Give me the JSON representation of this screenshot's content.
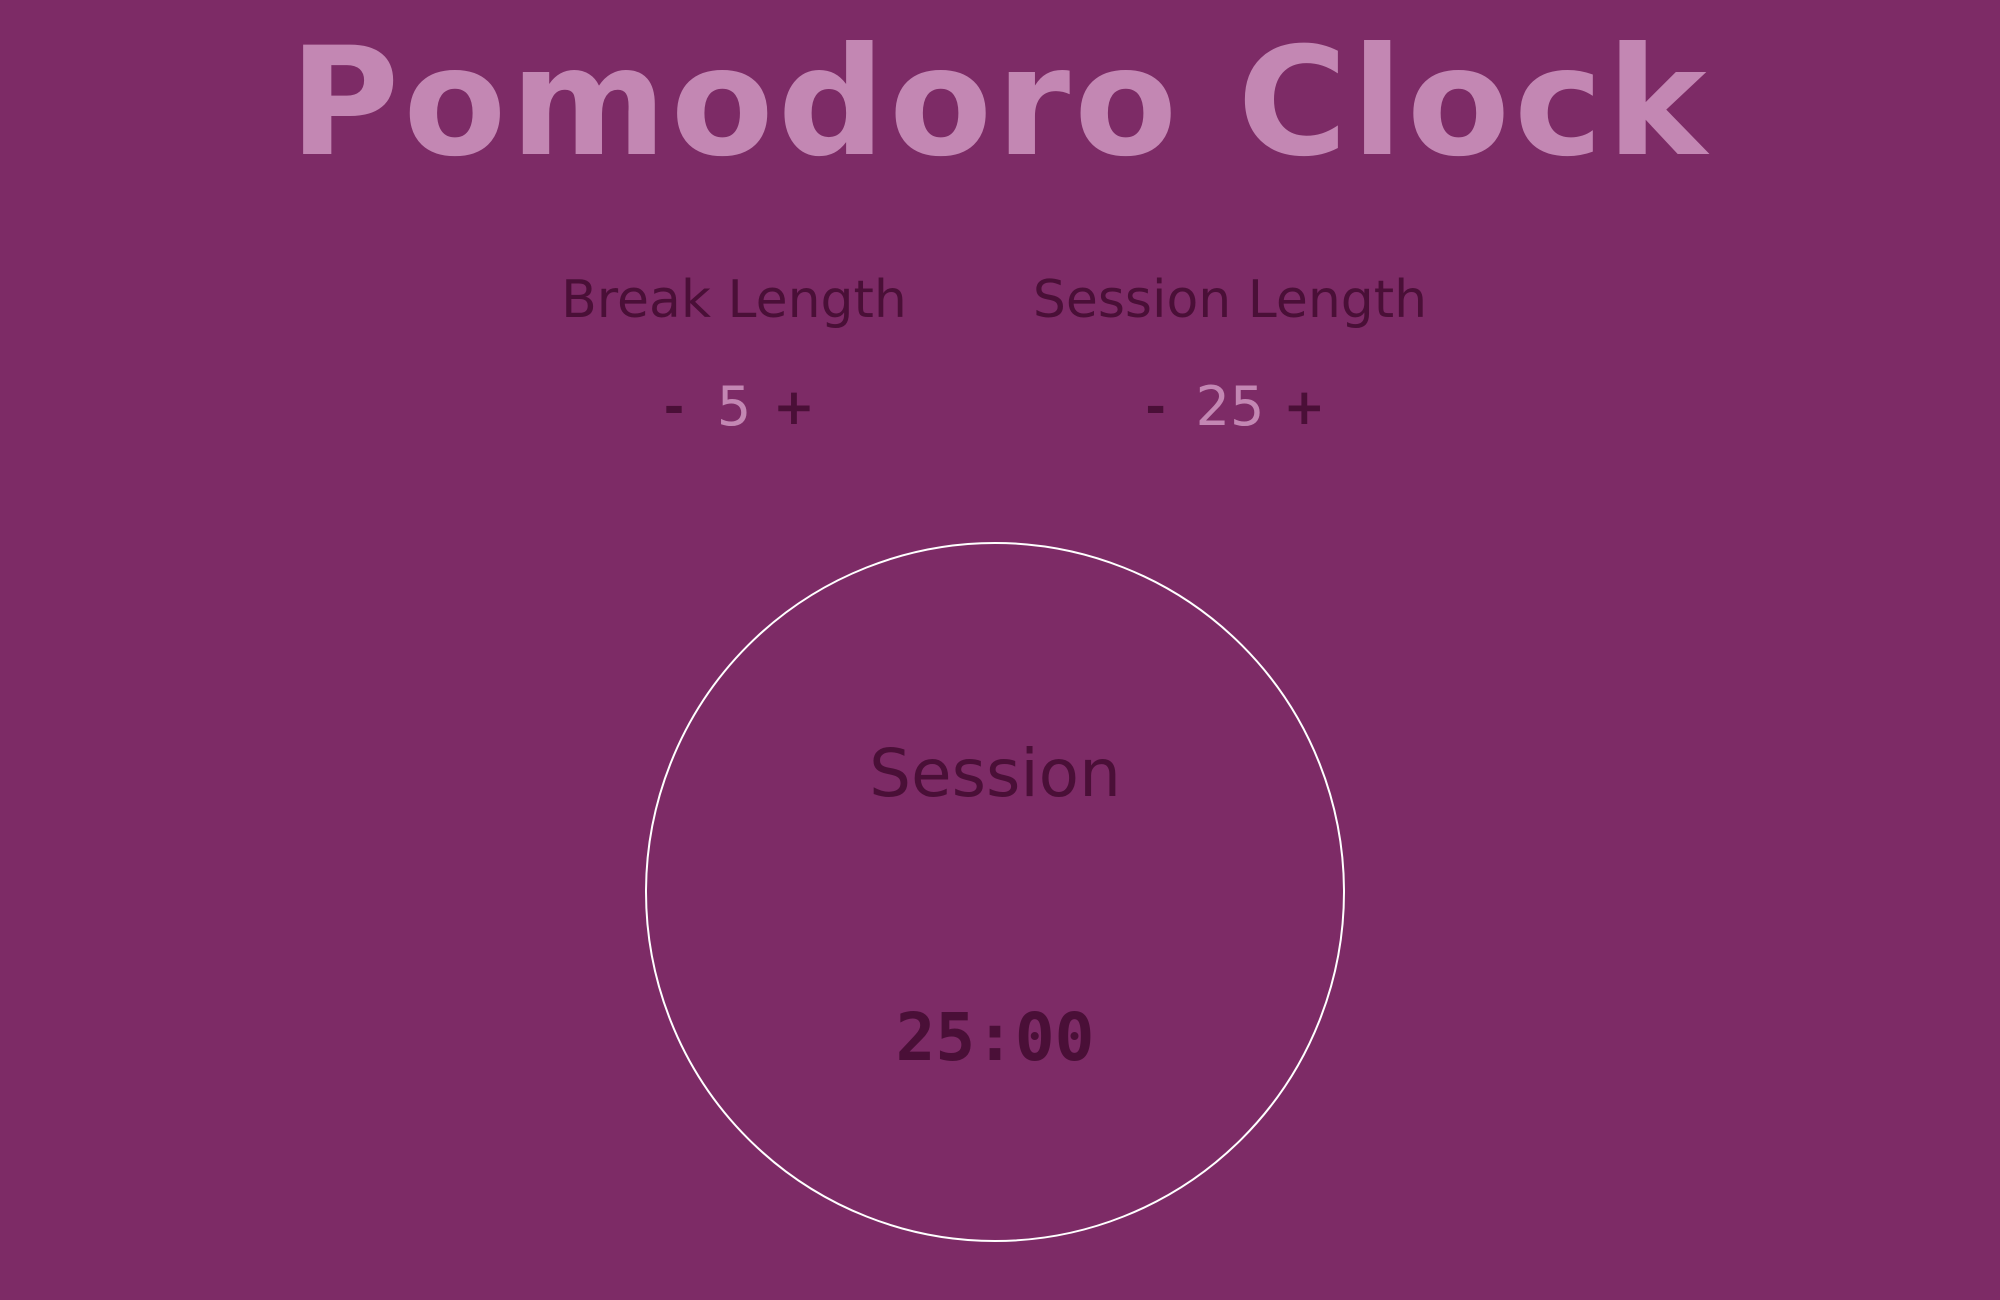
{
  "title": "Pomodoro Clock",
  "break": {
    "label": "Break Length",
    "decrement": "-",
    "value": "5",
    "increment": "+"
  },
  "session": {
    "label": "Session Length",
    "decrement": "-",
    "value": "25",
    "increment": "+"
  },
  "timer": {
    "label": "Session",
    "time": "25:00"
  },
  "colors": {
    "background": "#7d2b66",
    "title": "#c387b3",
    "text": "#4a0f37",
    "value": "#c387b3",
    "circle_border": "#ffffff"
  }
}
